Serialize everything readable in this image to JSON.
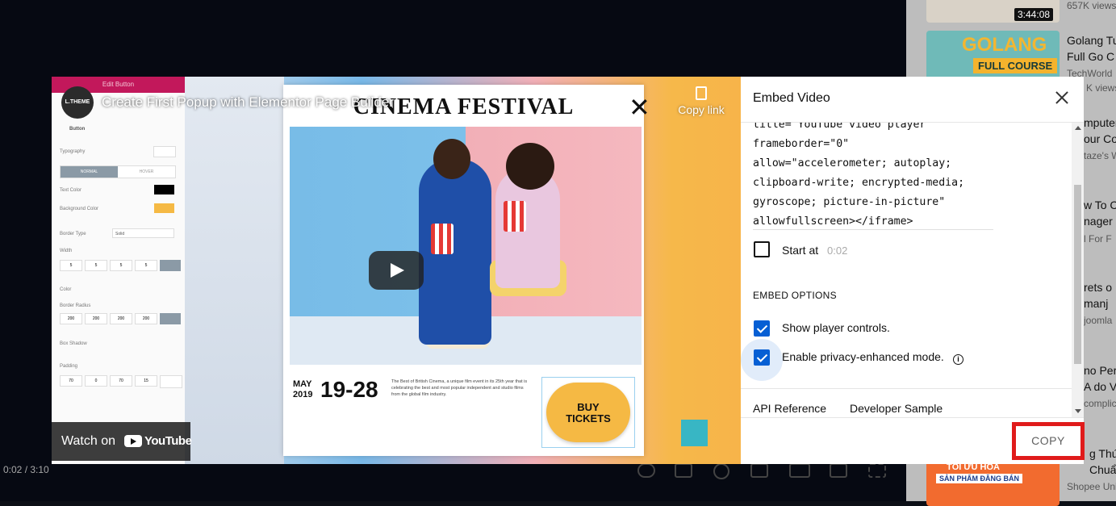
{
  "player": {
    "title": "Create First Popup with Elementor Page Builder",
    "channel_avatar_text": "L.THEME",
    "copy_link": "Copy link",
    "watch_on": "Watch on",
    "youtube_word": "YouTube",
    "time": "0:02 / 3:10"
  },
  "editor": {
    "header": "Edit Button",
    "section": "Button",
    "typography": "Typography",
    "normal": "NORMAL",
    "hover": "HOVER",
    "text_color": "Text Color",
    "background_color": "Background Color",
    "border_type": "Border Type",
    "border_type_value": "Solid",
    "width": "Width",
    "width_values": [
      "5",
      "5",
      "5",
      "5"
    ],
    "color": "Color",
    "border_radius": "Border Radius",
    "radius_values": [
      "200",
      "200",
      "200",
      "200"
    ],
    "box_shadow": "Box Shadow",
    "padding": "Padding",
    "padding_values": [
      "70",
      "0",
      "70",
      "15"
    ]
  },
  "poster": {
    "title": "CINEMA FESTIVAL",
    "month": "MAY",
    "year": "2019",
    "range": "19-28",
    "description": "The Best of British Cinema, a unique film event in its 25th year that is celebrating the best and most popular independent and studio films from the global film industry.",
    "buy_line1": "BUY",
    "buy_line2": "TICKETS"
  },
  "embed": {
    "title": "Embed Video",
    "code": "title=\"YouTube video player\"\nframeborder=\"0\"\nallow=\"accelerometer; autoplay;\nclipboard-write; encrypted-media;\ngyroscope; picture-in-picture\"\nallowfullscreen></iframe>",
    "start_at": "Start at",
    "start_time": "0:02",
    "options_heading": "EMBED OPTIONS",
    "show_controls": "Show player controls.",
    "privacy_mode": "Enable privacy-enhanced mode.",
    "api_reference": "API Reference",
    "developer_sample": "Developer Sample",
    "copy": "COPY"
  },
  "sidebar": {
    "items": [
      {
        "title": "",
        "meta": "657K views",
        "duration": "3:44:08"
      },
      {
        "title": "Golang Tu\nFull Go C",
        "meta": "TechWorld",
        "thumb_text": "GOLANG",
        "thumb_sub": "FULL COURSE"
      },
      {
        "title": "",
        "meta": "K views"
      },
      {
        "title": "mputer\nour Co",
        "meta": "taze's W"
      },
      {
        "title": "w To C\nnager",
        "meta": "l For F"
      },
      {
        "title": "rets o\nmanj",
        "meta": "joomla"
      },
      {
        "title": "no Per\nA do V",
        "meta": "complic"
      },
      {
        "title": "g Thứ\nChuẩn SE",
        "meta": "Shopee Uni",
        "thumb_text": "TỐI ƯU HÓA",
        "thumb_sub": "SẢN PHẨM ĐĂNG BÁN"
      }
    ]
  },
  "colors": {
    "accent_blue": "#065fd4",
    "highlight_red": "#e01b1b",
    "poster_yellow": "#f5b944"
  }
}
